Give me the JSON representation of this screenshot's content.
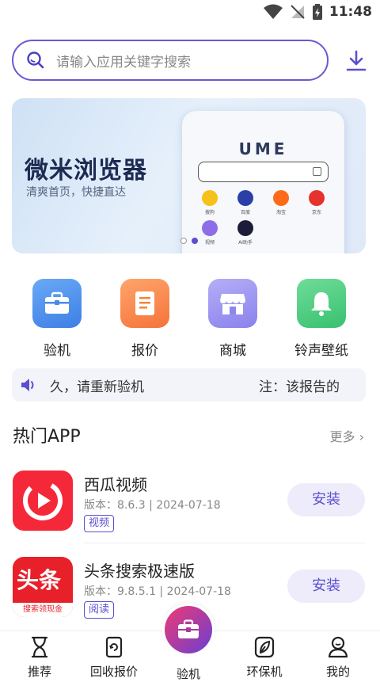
{
  "status_bar": {
    "time": "11:48"
  },
  "search": {
    "placeholder": "请输入应用关键字搜索"
  },
  "banner": {
    "title": "微米浏览器",
    "subtitle": "清爽首页，快捷直达",
    "phone_brand": "UME",
    "phone_apps": [
      "搜狗",
      "百度",
      "淘宝",
      "京东",
      "视频",
      "AI助手"
    ]
  },
  "quick_actions": [
    {
      "label": "验机",
      "icon": "briefcase-icon"
    },
    {
      "label": "报价",
      "icon": "document-icon"
    },
    {
      "label": "商城",
      "icon": "store-icon"
    },
    {
      "label": "铃声壁纸",
      "icon": "bell-icon"
    }
  ],
  "notice": {
    "text_left": "久，请重新验机",
    "text_right": "注：该报告的"
  },
  "hot_apps": {
    "title": "热门APP",
    "more_label": "更多",
    "apps": [
      {
        "name": "西瓜视频",
        "meta": "版本：8.6.3 | 2024-07-18",
        "tag": "视频",
        "install_label": "安装"
      },
      {
        "name": "头条搜索极速版",
        "meta": "版本：9.8.5.1 | 2024-07-18",
        "tag": "阅读",
        "install_label": "安装",
        "icon_text": "头条",
        "icon_sub": "搜索领现金"
      }
    ]
  },
  "tabbar": {
    "tabs": [
      {
        "label": "推荐",
        "icon": "hourglass-icon"
      },
      {
        "label": "回收报价",
        "icon": "phone-recycle-icon"
      },
      {
        "label": "验机",
        "icon": "briefcase-icon"
      },
      {
        "label": "环保机",
        "icon": "leaf-icon"
      },
      {
        "label": "我的",
        "icon": "user-icon"
      }
    ]
  },
  "colors": {
    "accent": "#5a4fd0",
    "search_border": "#6b59d3"
  }
}
